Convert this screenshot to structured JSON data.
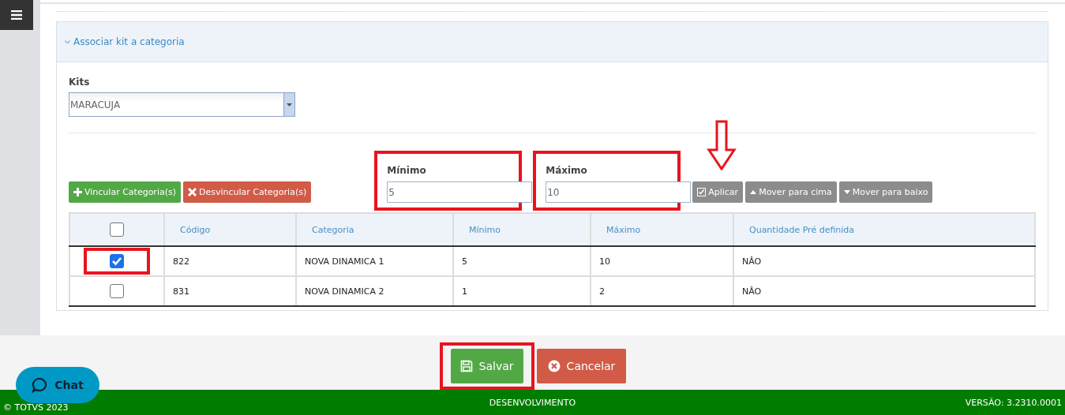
{
  "panel": {
    "title": "Associar kit a categoria",
    "expanded": true
  },
  "kits": {
    "label": "Kits",
    "value": "MARACUJA"
  },
  "actions": [
    {
      "label": "Vincular Categoria(s)",
      "kind": "add"
    },
    {
      "label": "Desvincular Categoria(s)",
      "kind": "remove"
    }
  ],
  "minimo": {
    "label": "Mínimo",
    "value": "5",
    "highlighted": true
  },
  "maximo": {
    "label": "Máximo",
    "value": "10",
    "highlighted": true
  },
  "tools": [
    {
      "label": "Aplicar",
      "kind": "apply",
      "arrow_marker": true
    },
    {
      "label": "Mover para cima",
      "kind": "up",
      "arrow_marker": false
    },
    {
      "label": "Mover para baixo",
      "kind": "down",
      "arrow_marker": false
    }
  ],
  "table": {
    "header_checked": false,
    "columns": [
      "Código",
      "Categoria",
      "Mínimo",
      "Máximo",
      "Quantidade Pré definida"
    ],
    "rows": [
      {
        "checked": true,
        "highlighted": true,
        "cells": [
          "822",
          "NOVA DINAMICA 1",
          "5",
          "10",
          "NÂO"
        ]
      },
      {
        "checked": false,
        "highlighted": false,
        "cells": [
          "831",
          "NOVA DINAMICA 2",
          "1",
          "2",
          "NÂO"
        ]
      }
    ]
  },
  "buttons": [
    {
      "label": "Salvar",
      "kind": "save",
      "highlighted": true
    },
    {
      "label": "Cancelar",
      "kind": "cancel",
      "highlighted": false
    }
  ],
  "chat": {
    "label": "Chat"
  },
  "status_bar": {
    "left": "© TOTVS 2023",
    "center": "DESENVOLVIMENTO",
    "right": "VERSÃO: 3.2310.0001"
  }
}
